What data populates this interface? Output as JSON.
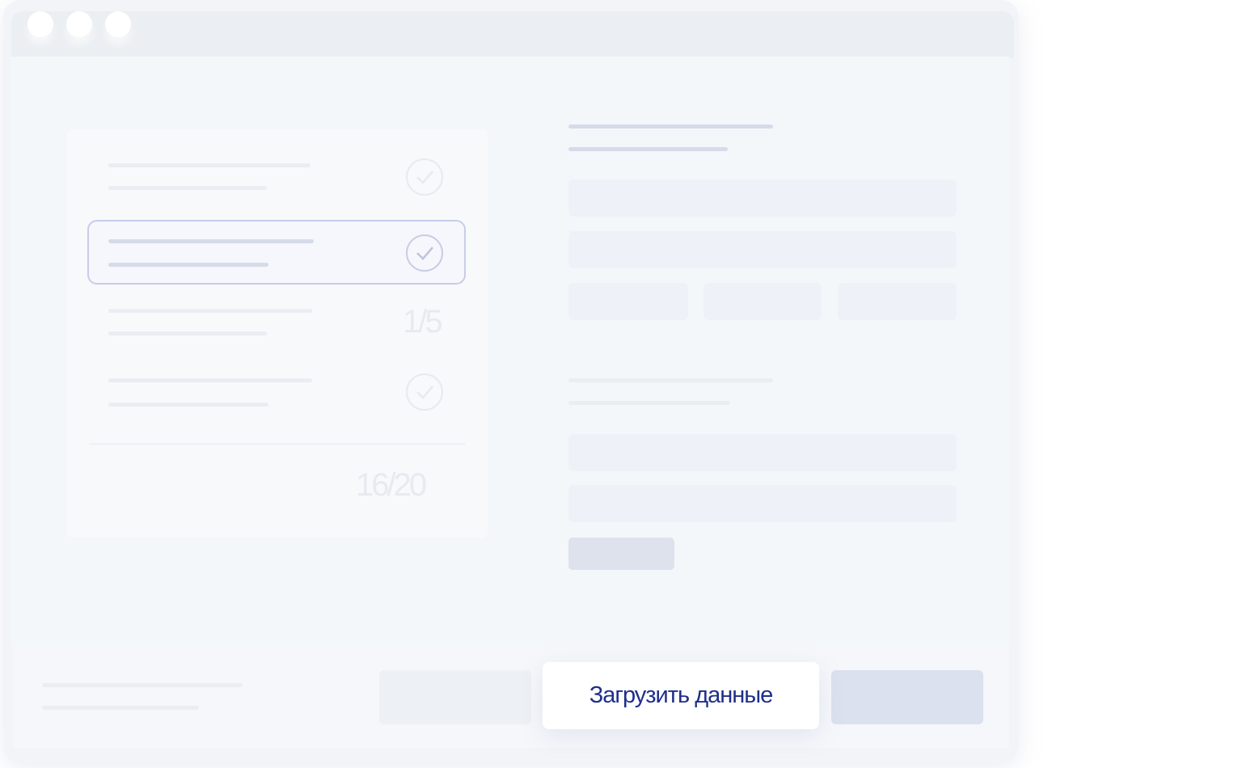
{
  "progress": {
    "item_counter": "1/5",
    "total_counter": "16/20"
  },
  "actions": {
    "load_data_label": "Загрузить данные"
  },
  "colors": {
    "accent_text": "#1f2f8a",
    "selected_border": "#c8cce8"
  },
  "icons": {
    "check": "check-circle-icon"
  }
}
